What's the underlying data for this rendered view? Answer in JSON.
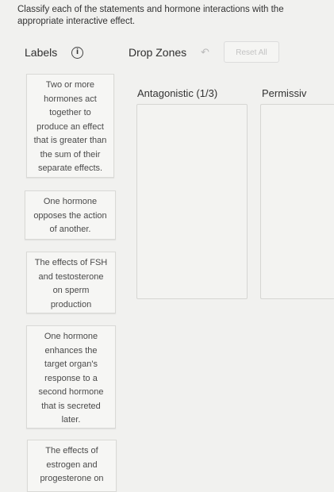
{
  "instructions": "Classify each of the statements and hormone interactions with the appropriate interactive effect.",
  "labels_header": "Labels",
  "info_icon": "info-icon",
  "drop_zones_header": "Drop Zones",
  "undo_icon": "undo-arrow-icon",
  "reset_label": "Reset All",
  "cards": [
    "Two or more\nhormones act\ntogether to\nproduce an effect\nthat is greater than\nthe sum of their\nseparate effects.",
    "One hormone\nopposes the action\nof another.",
    "The effects of FSH\nand testosterone\non sperm\nproduction",
    "One hormone\nenhances the\ntarget organ's\nresponse to a\nsecond hormone\nthat is secreted\nlater.",
    "The effects of\nestrogen and\nprogesterone on"
  ],
  "zones": [
    {
      "title": "Antagonistic (1/3)"
    },
    {
      "title": "Permissiv"
    }
  ]
}
